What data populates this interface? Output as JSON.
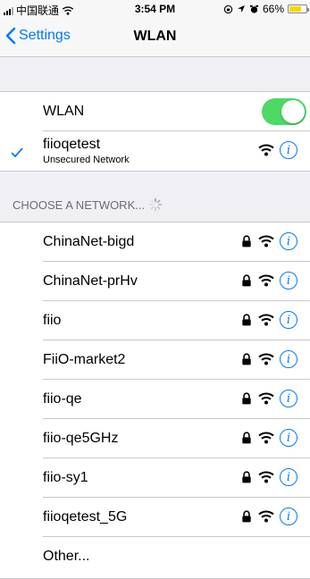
{
  "status_bar": {
    "carrier": "中国联通",
    "time": "3:54 PM",
    "battery": "66%"
  },
  "nav": {
    "back_label": "Settings",
    "title": "WLAN"
  },
  "wlan_toggle": {
    "label": "WLAN",
    "on": true
  },
  "connected": {
    "name": "fiioqetest",
    "subtitle": "Unsecured Network"
  },
  "section": {
    "header": "CHOOSE A NETWORK..."
  },
  "networks": [
    {
      "name": "ChinaNet-bigd",
      "locked": true
    },
    {
      "name": "ChinaNet-prHv",
      "locked": true
    },
    {
      "name": "fiio",
      "locked": true
    },
    {
      "name": "FiiO-market2",
      "locked": true
    },
    {
      "name": "fiio-qe",
      "locked": true
    },
    {
      "name": "fiio-qe5GHz",
      "locked": true
    },
    {
      "name": "fiio-sy1",
      "locked": true
    },
    {
      "name": "fiioqetest_5G",
      "locked": true
    }
  ],
  "other": {
    "label": "Other..."
  },
  "colors": {
    "accent": "#007aff",
    "toggle_on": "#4cd964",
    "battery": "#f7d900"
  }
}
